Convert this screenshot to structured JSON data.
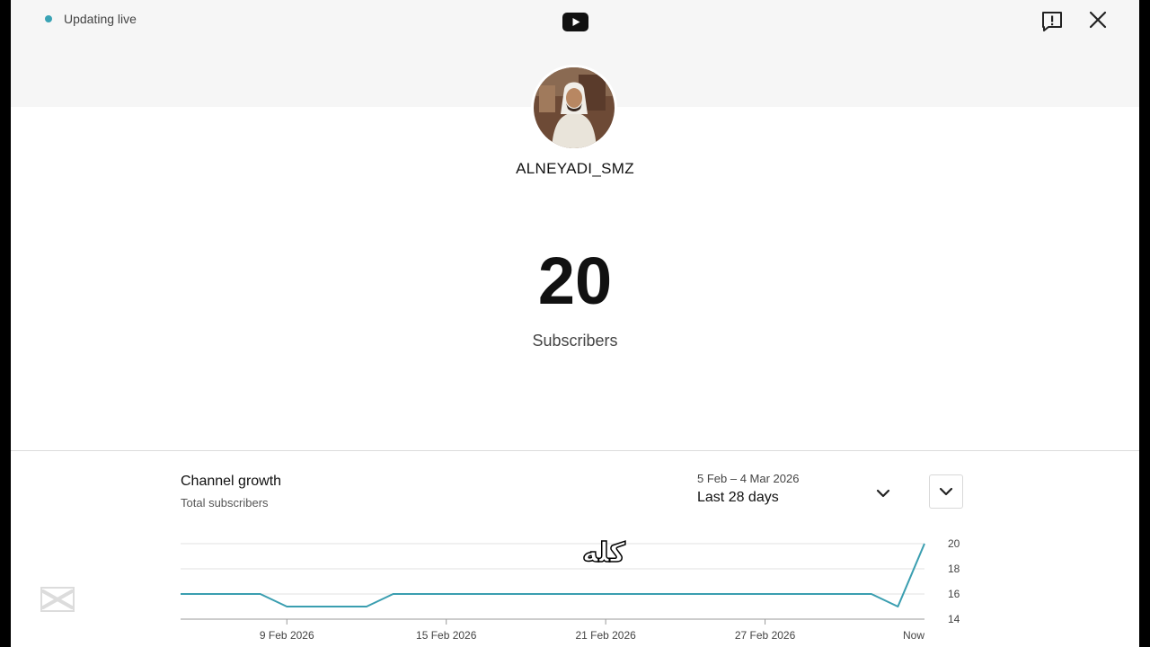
{
  "status": {
    "live_text": "Updating live"
  },
  "header": {
    "logo_icon": "youtube-icon",
    "feedback_icon": "feedback-icon",
    "close_icon": "close-icon"
  },
  "channel": {
    "name": "ALNEYADI_SMZ",
    "subscribers": "20",
    "subscribers_label": "Subscribers"
  },
  "growth": {
    "title": "Channel growth",
    "subtitle": "Total subscribers",
    "date_range": "5 Feb – 4 Mar 2026",
    "period": "Last 28 days"
  },
  "overlay_text": "كله",
  "colors": {
    "accent": "#3aa3b5",
    "line": "#3a9eb0",
    "gridline": "#e2e2e2"
  },
  "chart_data": {
    "type": "line",
    "title": "",
    "xlabel": "",
    "ylabel": "",
    "x_ticks": [
      "9 Feb 2026",
      "15 Feb 2026",
      "21 Feb 2026",
      "27 Feb 2026",
      "Now"
    ],
    "y_ticks": [
      20,
      18,
      16,
      14
    ],
    "ylim": [
      14,
      20
    ],
    "grid": true,
    "series": [
      {
        "values": [
          16,
          16,
          16,
          16,
          15,
          15,
          15,
          15,
          16,
          16,
          16,
          16,
          16,
          16,
          16,
          16,
          16,
          16,
          16,
          16,
          16,
          16,
          16,
          16,
          16,
          16,
          16,
          15,
          20
        ]
      }
    ],
    "dates": [
      "5 Feb",
      "6 Feb",
      "7 Feb",
      "8 Feb",
      "9 Feb",
      "10 Feb",
      "11 Feb",
      "12 Feb",
      "13 Feb",
      "14 Feb",
      "15 Feb",
      "16 Feb",
      "17 Feb",
      "18 Feb",
      "19 Feb",
      "20 Feb",
      "21 Feb",
      "22 Feb",
      "23 Feb",
      "24 Feb",
      "25 Feb",
      "26 Feb",
      "27 Feb",
      "28 Feb",
      "1 Mar",
      "2 Mar",
      "3 Mar",
      "4 Mar",
      "Now"
    ]
  }
}
